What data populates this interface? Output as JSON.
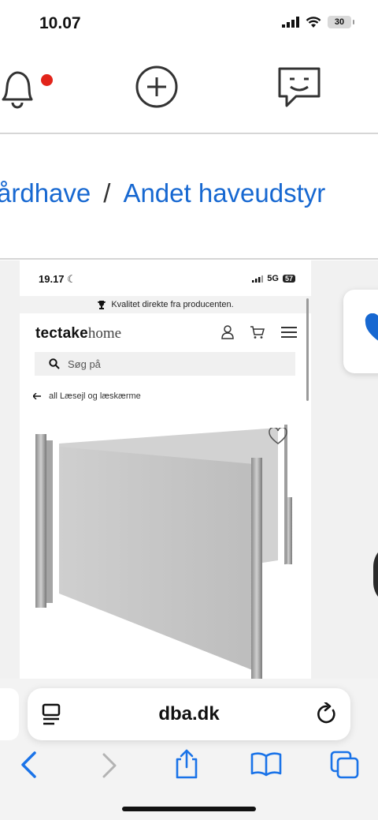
{
  "status_bar": {
    "time": "10.07",
    "battery": "30"
  },
  "breadcrumb": {
    "parent": "årdhave",
    "separator": "/",
    "current": "Andet haveudstyr"
  },
  "embedded": {
    "status_time": "19.17",
    "network": "5G",
    "battery": "57",
    "promo_text": "Kvalitet direkte fra producenten.",
    "brand_bold": "tectake",
    "brand_light": "home",
    "search_placeholder": "Søg på",
    "back_link": "all Læsejl og læskærme"
  },
  "browser": {
    "url": "dba.dk"
  },
  "colors": {
    "link": "#1768d1",
    "notification": "#e2241a",
    "toolbar_blue": "#1a73e8"
  }
}
